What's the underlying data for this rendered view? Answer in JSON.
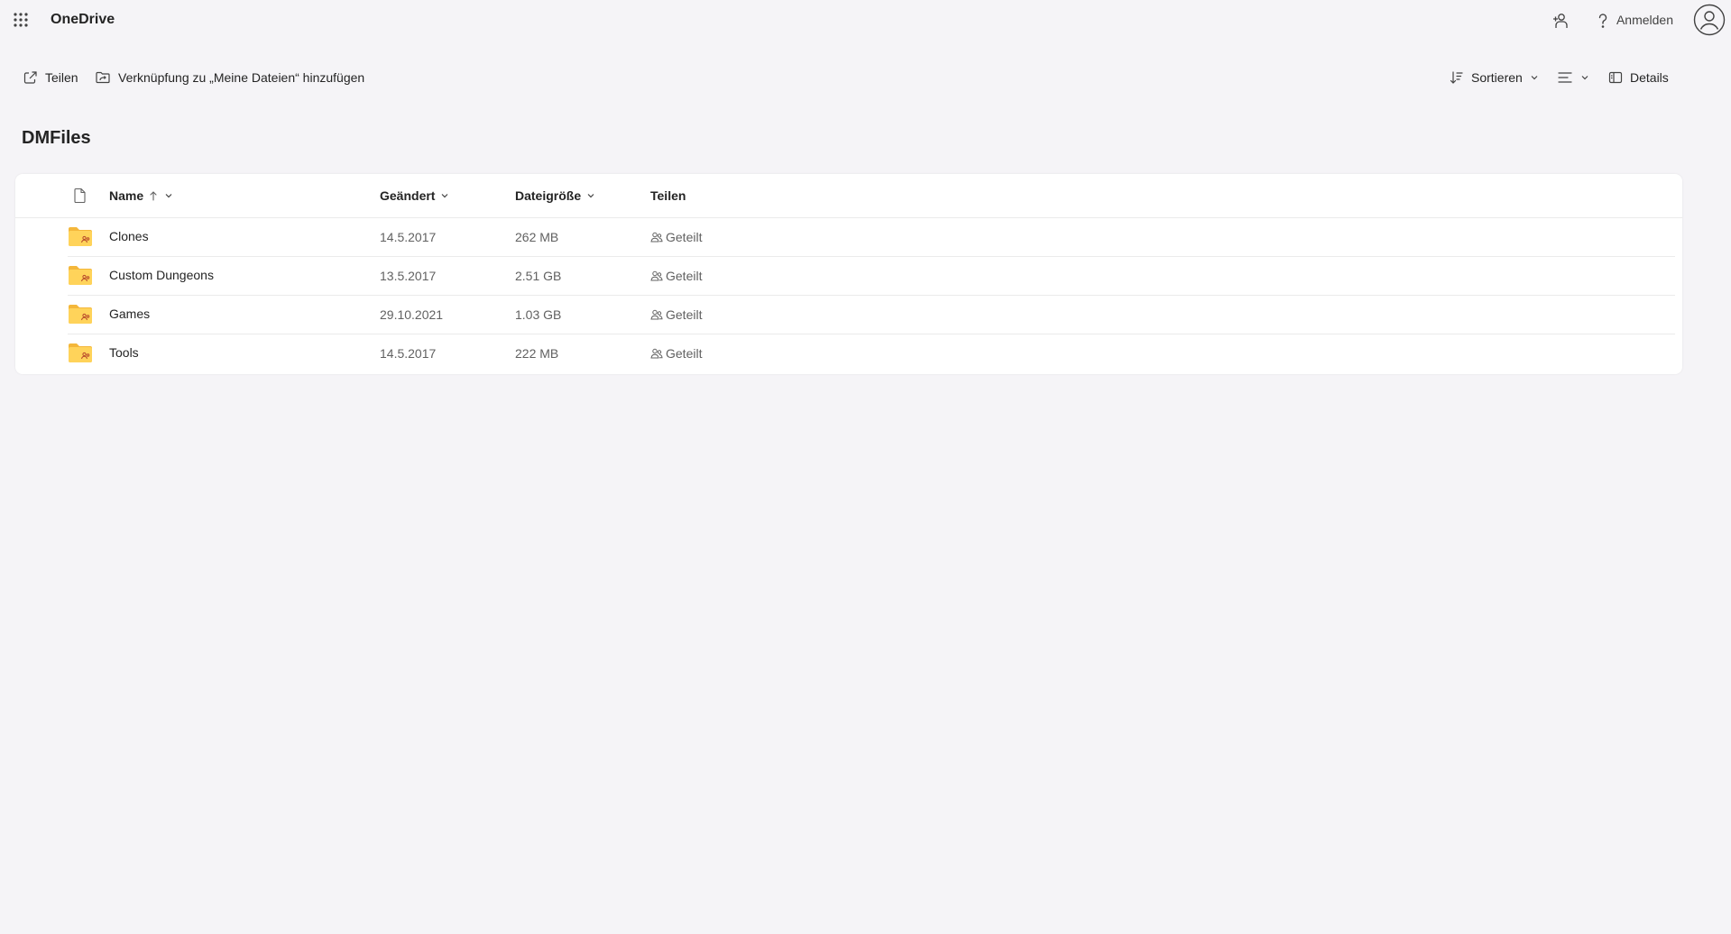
{
  "header": {
    "app_title": "OneDrive",
    "signin_label": "Anmelden",
    "icons": [
      "waffle-icon",
      "share-feedback-icon",
      "help-icon",
      "avatar-icon"
    ]
  },
  "commands": {
    "share_label": "Teilen",
    "add_shortcut_label": "Verknüpfung zu „Meine Dateien“ hinzufügen",
    "sort_label": "Sortieren",
    "details_label": "Details"
  },
  "page": {
    "title": "DMFiles"
  },
  "columns": {
    "name": "Name",
    "modified": "Geändert",
    "size": "Dateigröße",
    "sharing": "Teilen"
  },
  "files": [
    {
      "name": "Clones",
      "modified": "14.5.2017",
      "size": "262 MB",
      "sharing": "Geteilt"
    },
    {
      "name": "Custom Dungeons",
      "modified": "13.5.2017",
      "size": "2.51 GB",
      "sharing": "Geteilt"
    },
    {
      "name": "Games",
      "modified": "29.10.2021",
      "size": "1.03 GB",
      "sharing": "Geteilt"
    },
    {
      "name": "Tools",
      "modified": "14.5.2017",
      "size": "222 MB",
      "sharing": "Geteilt"
    }
  ],
  "colors": {
    "background": "#f5f4f7",
    "surface": "#ffffff",
    "folder": "#ffc83d",
    "text": "#242424",
    "secondary_text": "#616161"
  }
}
